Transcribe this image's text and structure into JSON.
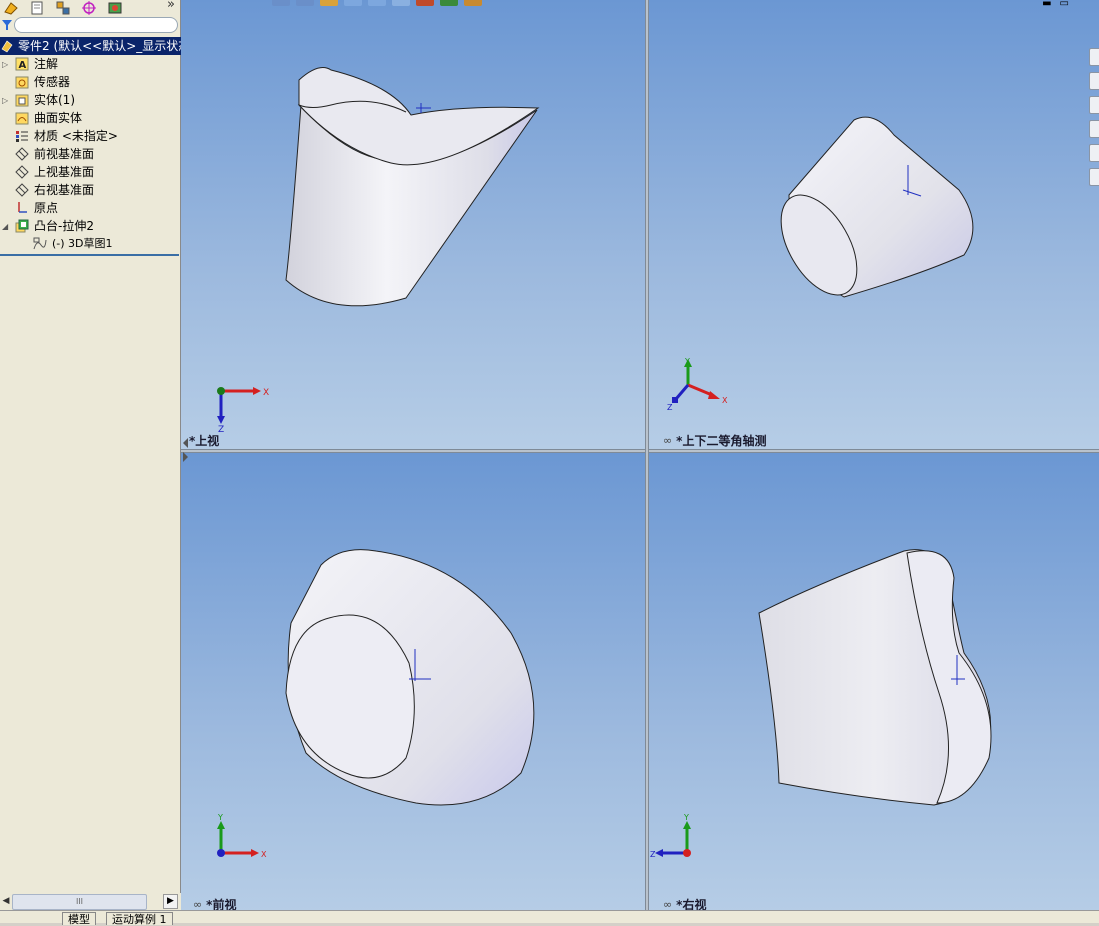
{
  "feature_manager": {
    "filter_placeholder": "",
    "root": "零件2 (默认<<默认>_显示状态",
    "items": [
      {
        "label": "注解",
        "icon": "annotations-icon"
      },
      {
        "label": "传感器",
        "icon": "sensors-icon"
      },
      {
        "label": "实体(1)",
        "icon": "solid-bodies-icon"
      },
      {
        "label": "曲面实体",
        "icon": "surface-bodies-icon"
      },
      {
        "label": "材质 <未指定>",
        "icon": "material-icon"
      },
      {
        "label": "前视基准面",
        "icon": "plane-icon"
      },
      {
        "label": "上视基准面",
        "icon": "plane-icon"
      },
      {
        "label": "右视基准面",
        "icon": "plane-icon"
      },
      {
        "label": "原点",
        "icon": "origin-icon"
      },
      {
        "label": "凸台-拉伸2",
        "icon": "extrude-icon"
      },
      {
        "label": "(-) 3D草图1",
        "icon": "sketch-3d-icon"
      }
    ],
    "tabs_more": "»",
    "scroll_thumb": "III"
  },
  "viewports": {
    "top_left": {
      "label": "*上视"
    },
    "top_right": {
      "label": "*上下二等角轴测"
    },
    "bottom_left": {
      "label": "*前视"
    },
    "bottom_right": {
      "label": "*右视"
    }
  },
  "bottom_tabs": {
    "model": "模型",
    "motion": "运动算例 1"
  },
  "axes": {
    "x": "X",
    "y": "Y",
    "z": "Z"
  },
  "colors": {
    "viewport_top": "#6b97d3",
    "viewport_bottom": "#b6cde6",
    "selection": "#0a246a",
    "axis_x": "#d42020",
    "axis_y": "#1a9a1a",
    "axis_z": "#2020c0"
  }
}
